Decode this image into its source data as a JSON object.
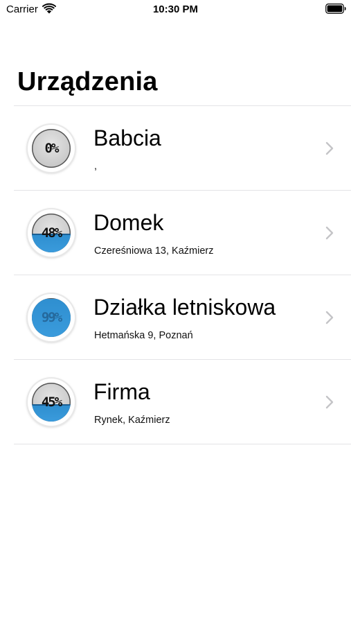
{
  "status_bar": {
    "carrier": "Carrier",
    "time": "10:30 PM"
  },
  "page": {
    "title": "Urządzenia"
  },
  "devices": [
    {
      "name": "Babcia",
      "address": ",",
      "level_label": "0%",
      "fill_fraction": 0.0
    },
    {
      "name": "Domek",
      "address": "Czereśniowa 13, Kaźmierz",
      "level_label": "48%",
      "fill_fraction": 0.48
    },
    {
      "name": "Działka letniskowa",
      "address": "Hetmańska 9, Poznań",
      "level_label": "99%",
      "fill_fraction": 0.99
    },
    {
      "name": "Firma",
      "address": "Rynek, Kaźmierz",
      "level_label": "45%",
      "fill_fraction": 0.45
    }
  ],
  "icons": {
    "wifi": "wifi-icon",
    "battery": "battery-icon",
    "chevron": "chevron-right-icon"
  },
  "colors": {
    "accent_water": "#3a9bdc",
    "separator": "#e3e3e6",
    "chevron": "#c4c4c7"
  }
}
